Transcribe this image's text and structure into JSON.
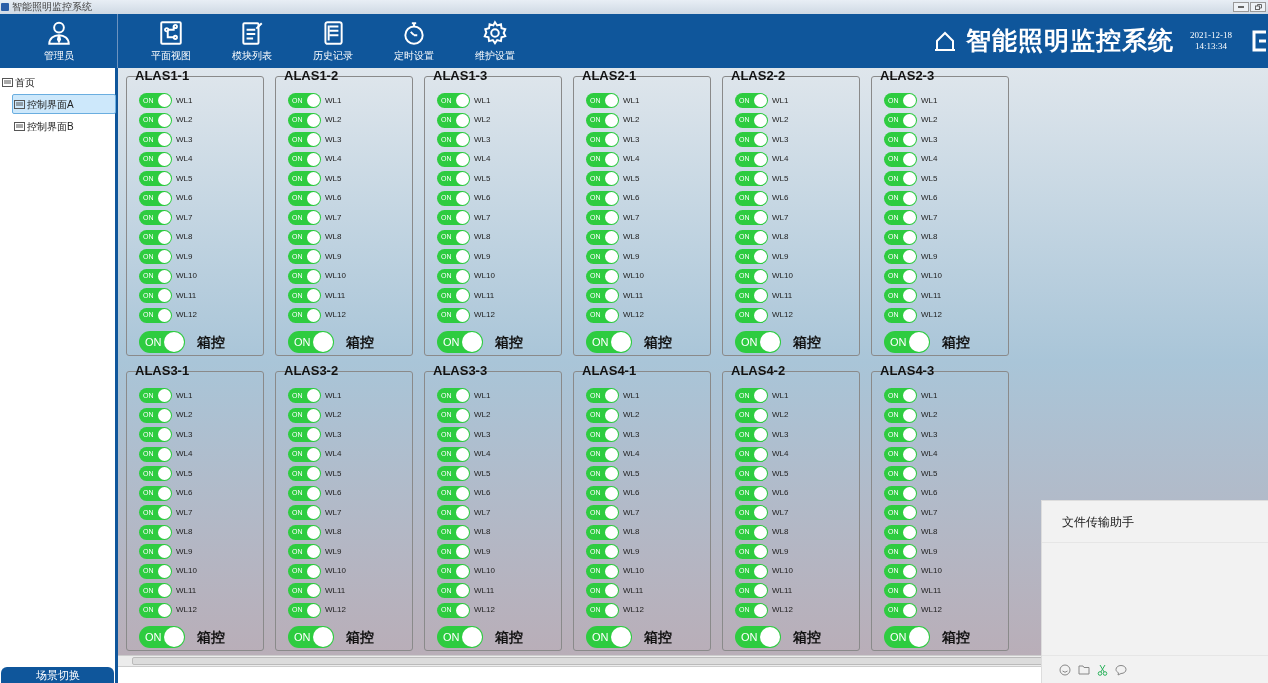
{
  "window": {
    "title": "智能照明监控系统"
  },
  "header": {
    "user": {
      "label": "管理员",
      "kind": "user"
    },
    "nav": [
      {
        "label": "平面视图",
        "kind": "plan",
        "selected": false
      },
      {
        "label": "模块列表",
        "kind": "list",
        "selected": false
      },
      {
        "label": "历史记录",
        "kind": "history",
        "selected": false
      },
      {
        "label": "定时设置",
        "kind": "timer",
        "selected": false
      },
      {
        "label": "维护设置",
        "kind": "gear",
        "selected": false
      }
    ],
    "system_title": "智能照明监控系统",
    "date": "2021-12-18",
    "time": "14:13:34"
  },
  "sidebar": {
    "tree": [
      {
        "label": "首页",
        "selected": false,
        "children": [
          {
            "label": "控制界面A",
            "selected": true
          },
          {
            "label": "控制界面B",
            "selected": false
          }
        ]
      }
    ],
    "scene_button": "场景切换"
  },
  "groups": [
    {
      "name": "ALAS1-1",
      "switches": [
        {
          "label": "WL1",
          "text": "ON",
          "on": true
        },
        {
          "label": "WL2",
          "text": "ON",
          "on": true
        },
        {
          "label": "WL3",
          "text": "ON",
          "on": true
        },
        {
          "label": "WL4",
          "text": "ON",
          "on": true
        },
        {
          "label": "WL5",
          "text": "ON",
          "on": true
        },
        {
          "label": "WL6",
          "text": "ON",
          "on": true
        },
        {
          "label": "WL7",
          "text": "ON",
          "on": true
        },
        {
          "label": "WL8",
          "text": "ON",
          "on": true
        },
        {
          "label": "WL9",
          "text": "ON",
          "on": true
        },
        {
          "label": "WL10",
          "text": "ON",
          "on": true
        },
        {
          "label": "WL11",
          "text": "ON",
          "on": true
        },
        {
          "label": "WL12",
          "text": "ON",
          "on": true
        }
      ],
      "box": {
        "label": "箱控",
        "text": "ON",
        "on": true
      }
    },
    {
      "name": "ALAS1-2",
      "switches": [
        {
          "label": "WL1",
          "text": "ON",
          "on": true
        },
        {
          "label": "WL2",
          "text": "ON",
          "on": true
        },
        {
          "label": "WL3",
          "text": "ON",
          "on": true
        },
        {
          "label": "WL4",
          "text": "ON",
          "on": true
        },
        {
          "label": "WL5",
          "text": "ON",
          "on": true
        },
        {
          "label": "WL6",
          "text": "ON",
          "on": true
        },
        {
          "label": "WL7",
          "text": "ON",
          "on": true
        },
        {
          "label": "WL8",
          "text": "ON",
          "on": true
        },
        {
          "label": "WL9",
          "text": "ON",
          "on": true
        },
        {
          "label": "WL10",
          "text": "ON",
          "on": true
        },
        {
          "label": "WL11",
          "text": "ON",
          "on": true
        },
        {
          "label": "WL12",
          "text": "ON",
          "on": true
        }
      ],
      "box": {
        "label": "箱控",
        "text": "ON",
        "on": true
      }
    },
    {
      "name": "ALAS1-3",
      "switches": [
        {
          "label": "WL1",
          "text": "ON",
          "on": true
        },
        {
          "label": "WL2",
          "text": "ON",
          "on": true
        },
        {
          "label": "WL3",
          "text": "ON",
          "on": true
        },
        {
          "label": "WL4",
          "text": "ON",
          "on": true
        },
        {
          "label": "WL5",
          "text": "ON",
          "on": true
        },
        {
          "label": "WL6",
          "text": "ON",
          "on": true
        },
        {
          "label": "WL7",
          "text": "ON",
          "on": true
        },
        {
          "label": "WL8",
          "text": "ON",
          "on": true
        },
        {
          "label": "WL9",
          "text": "ON",
          "on": true
        },
        {
          "label": "WL10",
          "text": "ON",
          "on": true
        },
        {
          "label": "WL11",
          "text": "ON",
          "on": true
        },
        {
          "label": "WL12",
          "text": "ON",
          "on": true
        }
      ],
      "box": {
        "label": "箱控",
        "text": "ON",
        "on": true
      }
    },
    {
      "name": "ALAS2-1",
      "switches": [
        {
          "label": "WL1",
          "text": "ON",
          "on": true
        },
        {
          "label": "WL2",
          "text": "ON",
          "on": true
        },
        {
          "label": "WL3",
          "text": "ON",
          "on": true
        },
        {
          "label": "WL4",
          "text": "ON",
          "on": true
        },
        {
          "label": "WL5",
          "text": "ON",
          "on": true
        },
        {
          "label": "WL6",
          "text": "ON",
          "on": true
        },
        {
          "label": "WL7",
          "text": "ON",
          "on": true
        },
        {
          "label": "WL8",
          "text": "ON",
          "on": true
        },
        {
          "label": "WL9",
          "text": "ON",
          "on": true
        },
        {
          "label": "WL10",
          "text": "ON",
          "on": true
        },
        {
          "label": "WL11",
          "text": "ON",
          "on": true
        },
        {
          "label": "WL12",
          "text": "ON",
          "on": true
        }
      ],
      "box": {
        "label": "箱控",
        "text": "ON",
        "on": true
      }
    },
    {
      "name": "ALAS2-2",
      "switches": [
        {
          "label": "WL1",
          "text": "ON",
          "on": true
        },
        {
          "label": "WL2",
          "text": "ON",
          "on": true
        },
        {
          "label": "WL3",
          "text": "ON",
          "on": true
        },
        {
          "label": "WL4",
          "text": "ON",
          "on": true
        },
        {
          "label": "WL5",
          "text": "ON",
          "on": true
        },
        {
          "label": "WL6",
          "text": "ON",
          "on": true
        },
        {
          "label": "WL7",
          "text": "ON",
          "on": true
        },
        {
          "label": "WL8",
          "text": "ON",
          "on": true
        },
        {
          "label": "WL9",
          "text": "ON",
          "on": true
        },
        {
          "label": "WL10",
          "text": "ON",
          "on": true
        },
        {
          "label": "WL11",
          "text": "ON",
          "on": true
        },
        {
          "label": "WL12",
          "text": "ON",
          "on": true
        }
      ],
      "box": {
        "label": "箱控",
        "text": "ON",
        "on": true
      }
    },
    {
      "name": "ALAS2-3",
      "switches": [
        {
          "label": "WL1",
          "text": "ON",
          "on": true
        },
        {
          "label": "WL2",
          "text": "ON",
          "on": true
        },
        {
          "label": "WL3",
          "text": "ON",
          "on": true
        },
        {
          "label": "WL4",
          "text": "ON",
          "on": true
        },
        {
          "label": "WL5",
          "text": "ON",
          "on": true
        },
        {
          "label": "WL6",
          "text": "ON",
          "on": true
        },
        {
          "label": "WL7",
          "text": "ON",
          "on": true
        },
        {
          "label": "WL8",
          "text": "ON",
          "on": true
        },
        {
          "label": "WL9",
          "text": "ON",
          "on": true
        },
        {
          "label": "WL10",
          "text": "ON",
          "on": true
        },
        {
          "label": "WL11",
          "text": "ON",
          "on": true
        },
        {
          "label": "WL12",
          "text": "ON",
          "on": true
        }
      ],
      "box": {
        "label": "箱控",
        "text": "ON",
        "on": true
      }
    },
    {
      "name": "ALAS3-1",
      "switches": [
        {
          "label": "WL1",
          "text": "ON",
          "on": true
        },
        {
          "label": "WL2",
          "text": "ON",
          "on": true
        },
        {
          "label": "WL3",
          "text": "ON",
          "on": true
        },
        {
          "label": "WL4",
          "text": "ON",
          "on": true
        },
        {
          "label": "WL5",
          "text": "ON",
          "on": true
        },
        {
          "label": "WL6",
          "text": "ON",
          "on": true
        },
        {
          "label": "WL7",
          "text": "ON",
          "on": true
        },
        {
          "label": "WL8",
          "text": "ON",
          "on": true
        },
        {
          "label": "WL9",
          "text": "ON",
          "on": true
        },
        {
          "label": "WL10",
          "text": "ON",
          "on": true
        },
        {
          "label": "WL11",
          "text": "ON",
          "on": true
        },
        {
          "label": "WL12",
          "text": "ON",
          "on": true
        }
      ],
      "box": {
        "label": "箱控",
        "text": "ON",
        "on": true
      }
    },
    {
      "name": "ALAS3-2",
      "switches": [
        {
          "label": "WL1",
          "text": "ON",
          "on": true
        },
        {
          "label": "WL2",
          "text": "ON",
          "on": true
        },
        {
          "label": "WL3",
          "text": "ON",
          "on": true
        },
        {
          "label": "WL4",
          "text": "ON",
          "on": true
        },
        {
          "label": "WL5",
          "text": "ON",
          "on": true
        },
        {
          "label": "WL6",
          "text": "ON",
          "on": true
        },
        {
          "label": "WL7",
          "text": "ON",
          "on": true
        },
        {
          "label": "WL8",
          "text": "ON",
          "on": true
        },
        {
          "label": "WL9",
          "text": "ON",
          "on": true
        },
        {
          "label": "WL10",
          "text": "ON",
          "on": true
        },
        {
          "label": "WL11",
          "text": "ON",
          "on": true
        },
        {
          "label": "WL12",
          "text": "ON",
          "on": true
        }
      ],
      "box": {
        "label": "箱控",
        "text": "ON",
        "on": true
      }
    },
    {
      "name": "ALAS3-3",
      "switches": [
        {
          "label": "WL1",
          "text": "ON",
          "on": true
        },
        {
          "label": "WL2",
          "text": "ON",
          "on": true
        },
        {
          "label": "WL3",
          "text": "ON",
          "on": true
        },
        {
          "label": "WL4",
          "text": "ON",
          "on": true
        },
        {
          "label": "WL5",
          "text": "ON",
          "on": true
        },
        {
          "label": "WL6",
          "text": "ON",
          "on": true
        },
        {
          "label": "WL7",
          "text": "ON",
          "on": true
        },
        {
          "label": "WL8",
          "text": "ON",
          "on": true
        },
        {
          "label": "WL9",
          "text": "ON",
          "on": true
        },
        {
          "label": "WL10",
          "text": "ON",
          "on": true
        },
        {
          "label": "WL11",
          "text": "ON",
          "on": true
        },
        {
          "label": "WL12",
          "text": "ON",
          "on": true
        }
      ],
      "box": {
        "label": "箱控",
        "text": "ON",
        "on": true
      }
    },
    {
      "name": "ALAS4-1",
      "switches": [
        {
          "label": "WL1",
          "text": "ON",
          "on": true
        },
        {
          "label": "WL2",
          "text": "ON",
          "on": true
        },
        {
          "label": "WL3",
          "text": "ON",
          "on": true
        },
        {
          "label": "WL4",
          "text": "ON",
          "on": true
        },
        {
          "label": "WL5",
          "text": "ON",
          "on": true
        },
        {
          "label": "WL6",
          "text": "ON",
          "on": true
        },
        {
          "label": "WL7",
          "text": "ON",
          "on": true
        },
        {
          "label": "WL8",
          "text": "ON",
          "on": true
        },
        {
          "label": "WL9",
          "text": "ON",
          "on": true
        },
        {
          "label": "WL10",
          "text": "ON",
          "on": true
        },
        {
          "label": "WL11",
          "text": "ON",
          "on": true
        },
        {
          "label": "WL12",
          "text": "ON",
          "on": true
        }
      ],
      "box": {
        "label": "箱控",
        "text": "ON",
        "on": true
      }
    },
    {
      "name": "ALAS4-2",
      "switches": [
        {
          "label": "WL1",
          "text": "ON",
          "on": true
        },
        {
          "label": "WL2",
          "text": "ON",
          "on": true
        },
        {
          "label": "WL3",
          "text": "ON",
          "on": true
        },
        {
          "label": "WL4",
          "text": "ON",
          "on": true
        },
        {
          "label": "WL5",
          "text": "ON",
          "on": true
        },
        {
          "label": "WL6",
          "text": "ON",
          "on": true
        },
        {
          "label": "WL7",
          "text": "ON",
          "on": true
        },
        {
          "label": "WL8",
          "text": "ON",
          "on": true
        },
        {
          "label": "WL9",
          "text": "ON",
          "on": true
        },
        {
          "label": "WL10",
          "text": "ON",
          "on": true
        },
        {
          "label": "WL11",
          "text": "ON",
          "on": true
        },
        {
          "label": "WL12",
          "text": "ON",
          "on": true
        }
      ],
      "box": {
        "label": "箱控",
        "text": "ON",
        "on": true
      }
    },
    {
      "name": "ALAS4-3",
      "switches": [
        {
          "label": "WL1",
          "text": "ON",
          "on": true
        },
        {
          "label": "WL2",
          "text": "ON",
          "on": true
        },
        {
          "label": "WL3",
          "text": "ON",
          "on": true
        },
        {
          "label": "WL4",
          "text": "ON",
          "on": true
        },
        {
          "label": "WL5",
          "text": "ON",
          "on": true
        },
        {
          "label": "WL6",
          "text": "ON",
          "on": true
        },
        {
          "label": "WL7",
          "text": "ON",
          "on": true
        },
        {
          "label": "WL8",
          "text": "ON",
          "on": true
        },
        {
          "label": "WL9",
          "text": "ON",
          "on": true
        },
        {
          "label": "WL10",
          "text": "ON",
          "on": true
        },
        {
          "label": "WL11",
          "text": "ON",
          "on": true
        },
        {
          "label": "WL12",
          "text": "ON",
          "on": true
        }
      ],
      "box": {
        "label": "箱控",
        "text": "ON",
        "on": true
      }
    }
  ],
  "chat_popup": {
    "title": "文件传输助手",
    "tools": [
      {
        "kind": "smile"
      },
      {
        "kind": "folder"
      },
      {
        "kind": "scissors"
      },
      {
        "kind": "bubble"
      }
    ]
  }
}
